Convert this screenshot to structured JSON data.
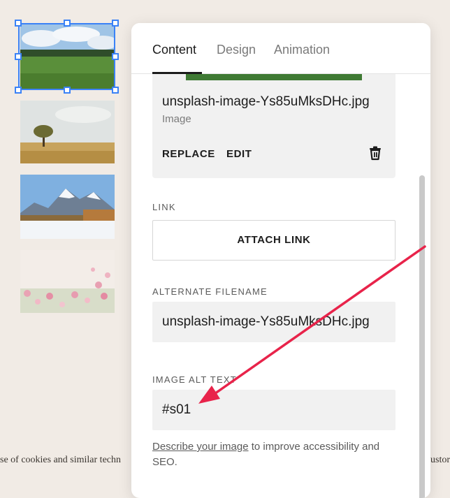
{
  "tabs": [
    {
      "label": "Content",
      "active": true
    },
    {
      "label": "Design",
      "active": false
    },
    {
      "label": "Animation",
      "active": false
    }
  ],
  "image_card": {
    "filename": "unsplash-image-Ys85uMksDHc.jpg",
    "type_label": "Image",
    "replace_label": "REPLACE",
    "edit_label": "EDIT",
    "delete_icon": "trash-icon"
  },
  "link_section": {
    "label": "LINK",
    "button_label": "ATTACH LINK"
  },
  "filename_section": {
    "label": "ALTERNATE FILENAME",
    "value": "unsplash-image-Ys85uMksDHc.jpg"
  },
  "alt_section": {
    "label": "IMAGE ALT TEXT",
    "value": "#s01"
  },
  "help": {
    "link_text": "Describe your image",
    "rest_text": " to improve accessibility and SEO."
  },
  "thumbnails": [
    {
      "name": "green-field",
      "selected": true
    },
    {
      "name": "lone-tree"
    },
    {
      "name": "snowy-mountains"
    },
    {
      "name": "pink-flowers"
    }
  ],
  "background_text": {
    "left": "se of cookies and similar techn",
    "right": "ustor"
  },
  "colors": {
    "selection": "#3b82f6",
    "annotation_arrow": "#e8234a",
    "background": "#f1ebe5"
  }
}
